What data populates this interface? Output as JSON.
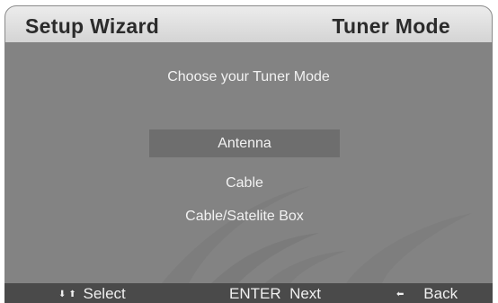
{
  "header": {
    "title": "Setup Wizard",
    "page": "Tuner Mode"
  },
  "main": {
    "prompt": "Choose your Tuner Mode",
    "options": [
      {
        "label": "Antenna",
        "selected": true
      },
      {
        "label": "Cable",
        "selected": false
      },
      {
        "label": "Cable/Satelite Box",
        "selected": false
      }
    ]
  },
  "footer": {
    "select_label": "Select",
    "enter_key": "ENTER",
    "enter_label": "Next",
    "back_label": "Back",
    "select_icons": [
      "arrow-down-icon",
      "arrow-up-icon"
    ],
    "back_icon": "arrow-left-icon"
  },
  "colors": {
    "panel": "#838383",
    "header": "#dcdcdc",
    "footer": "#4a4a4a",
    "highlight": "#6e6e6e",
    "text": "#f2f2f2"
  }
}
